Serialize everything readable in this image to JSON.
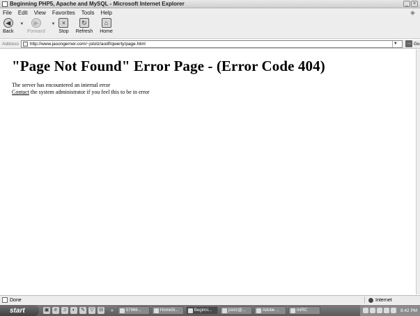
{
  "window": {
    "title": "Beginning PHP5, Apache and MySQL - Microsoft Internet Explorer"
  },
  "menu": [
    "File",
    "Edit",
    "View",
    "Favorites",
    "Tools",
    "Help"
  ],
  "toolbar": {
    "back": "Back",
    "forward": "Forward",
    "stop": "Stop",
    "refresh": "Refresh",
    "home": "Home"
  },
  "address": {
    "label": "Address",
    "url": "http://www.jasongerner.com/~jstolz/aodf/qwerty/page.html",
    "go": "Go"
  },
  "page": {
    "heading": "\"Page Not Found\" Error Page - (Error Code 404)",
    "line1": "The server has encountered an internal error",
    "contact_link": "Contact",
    "line2_rest": " the system administrator if you feel this to be in error"
  },
  "status": {
    "text": "Done",
    "zone": "Internet"
  },
  "taskbar": {
    "start": "start",
    "more": "»",
    "tasks": [
      "57966...",
      "HomeSi...",
      "Beginni...",
      "jstolz@...",
      "Adobe ...",
      "mIRC"
    ],
    "active_task": 2,
    "clock": "8:42 PM"
  }
}
